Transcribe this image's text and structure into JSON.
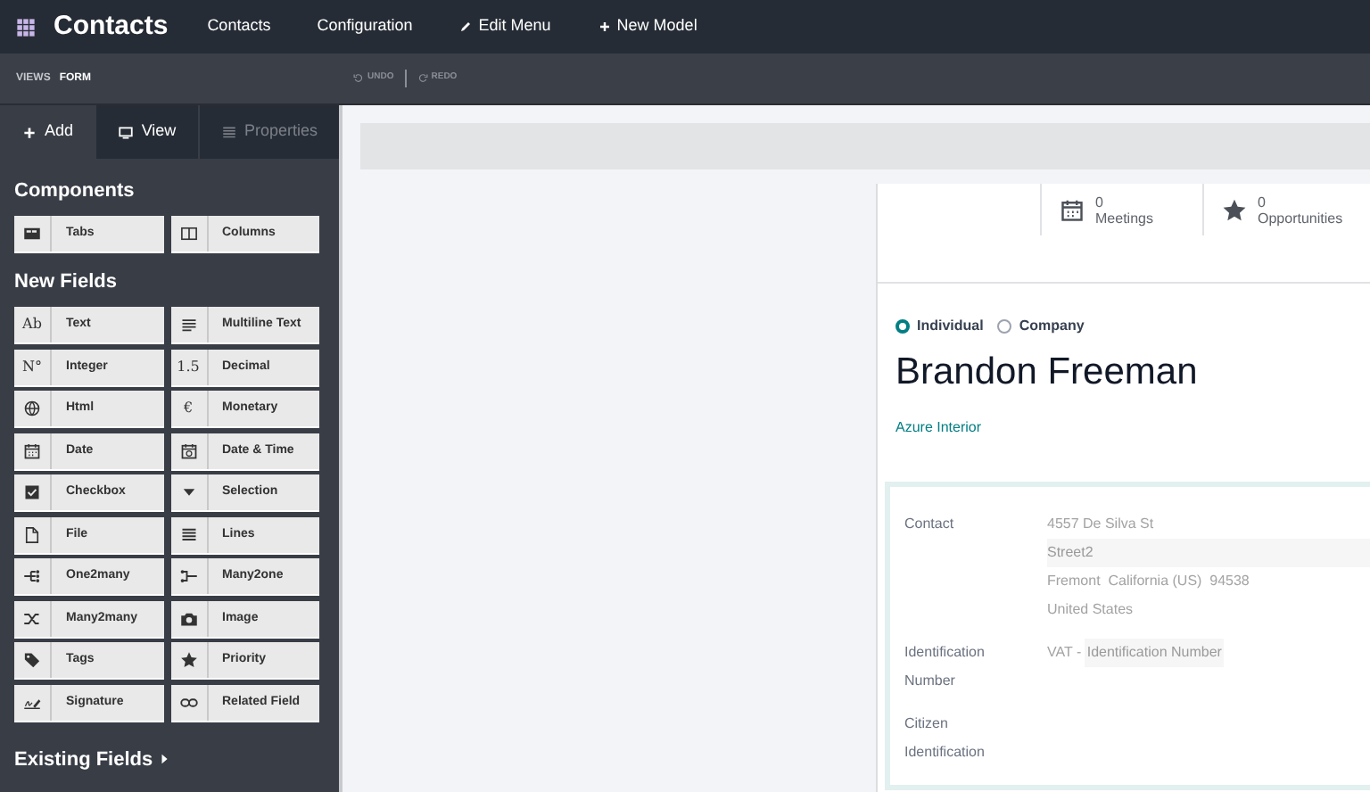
{
  "navbar": {
    "app_title": "Contacts",
    "menu": [
      {
        "label": "Contacts",
        "kind": "plain"
      },
      {
        "label": "Configuration",
        "kind": "plain"
      },
      {
        "label": "Edit Menu",
        "kind": "pencil"
      },
      {
        "label": "New Model",
        "kind": "plus"
      }
    ]
  },
  "subbar": {
    "breadcrumb": [
      "VIEWS",
      "FORM"
    ],
    "undo": "UNDO",
    "redo": "REDO"
  },
  "sidebar": {
    "tabs": [
      {
        "label": "Add",
        "kind": "plus",
        "selected": true,
        "disabled": false
      },
      {
        "label": "View",
        "kind": "monitor",
        "selected": false,
        "disabled": false
      },
      {
        "label": "Properties",
        "kind": "list",
        "selected": false,
        "disabled": true
      }
    ],
    "components_title": "Components",
    "components": [
      {
        "label": "Tabs",
        "kind": "tabs"
      },
      {
        "label": "Columns",
        "kind": "columns"
      }
    ],
    "new_fields_title": "New Fields",
    "new_fields": [
      {
        "label": "Text",
        "kind": "glyph",
        "glyph": "Ab"
      },
      {
        "label": "Multiline Text",
        "kind": "lines-text"
      },
      {
        "label": "Integer",
        "kind": "glyph",
        "glyph": "N°"
      },
      {
        "label": "Decimal",
        "kind": "glyph",
        "glyph": "1.5"
      },
      {
        "label": "Html",
        "kind": "globe"
      },
      {
        "label": "Monetary",
        "kind": "glyph",
        "glyph": "€"
      },
      {
        "label": "Date",
        "kind": "calendar"
      },
      {
        "label": "Date & Time",
        "kind": "calendar-clock"
      },
      {
        "label": "Checkbox",
        "kind": "checkbox"
      },
      {
        "label": "Selection",
        "kind": "triangle"
      },
      {
        "label": "File",
        "kind": "file"
      },
      {
        "label": "Lines",
        "kind": "list"
      },
      {
        "label": "One2many",
        "kind": "one2many"
      },
      {
        "label": "Many2one",
        "kind": "many2one"
      },
      {
        "label": "Many2many",
        "kind": "shuffle"
      },
      {
        "label": "Image",
        "kind": "camera"
      },
      {
        "label": "Tags",
        "kind": "tag"
      },
      {
        "label": "Priority",
        "kind": "star"
      },
      {
        "label": "Signature",
        "kind": "signature"
      },
      {
        "label": "Related Field",
        "kind": "link"
      }
    ],
    "existing_fields_title": "Existing Fields"
  },
  "form": {
    "stat_buttons": [
      {
        "kind": "calendar",
        "value": "0",
        "label": "Meetings"
      },
      {
        "kind": "star",
        "value": "0",
        "label": "Opportunities"
      }
    ],
    "company_type": [
      {
        "label": "Individual",
        "selected": true
      },
      {
        "label": "Company",
        "selected": false
      }
    ],
    "name": "Brandon Freeman",
    "parent_company": "Azure Interior",
    "fields": [
      {
        "label": "Contact",
        "lines": [
          {
            "text": "4557 De Silva St",
            "kind": "value"
          },
          {
            "text": "Street2",
            "kind": "placeholder"
          },
          {
            "text": "Fremont  California (US)  94538",
            "kind": "value"
          },
          {
            "text": "United States",
            "kind": "value"
          }
        ]
      },
      {
        "label": "Identification Number",
        "lines": [
          {
            "text": "VAT - ",
            "kind": "value",
            "placeholder": "Identification Number"
          }
        ]
      },
      {
        "label": "Citizen Identification"
      }
    ]
  }
}
